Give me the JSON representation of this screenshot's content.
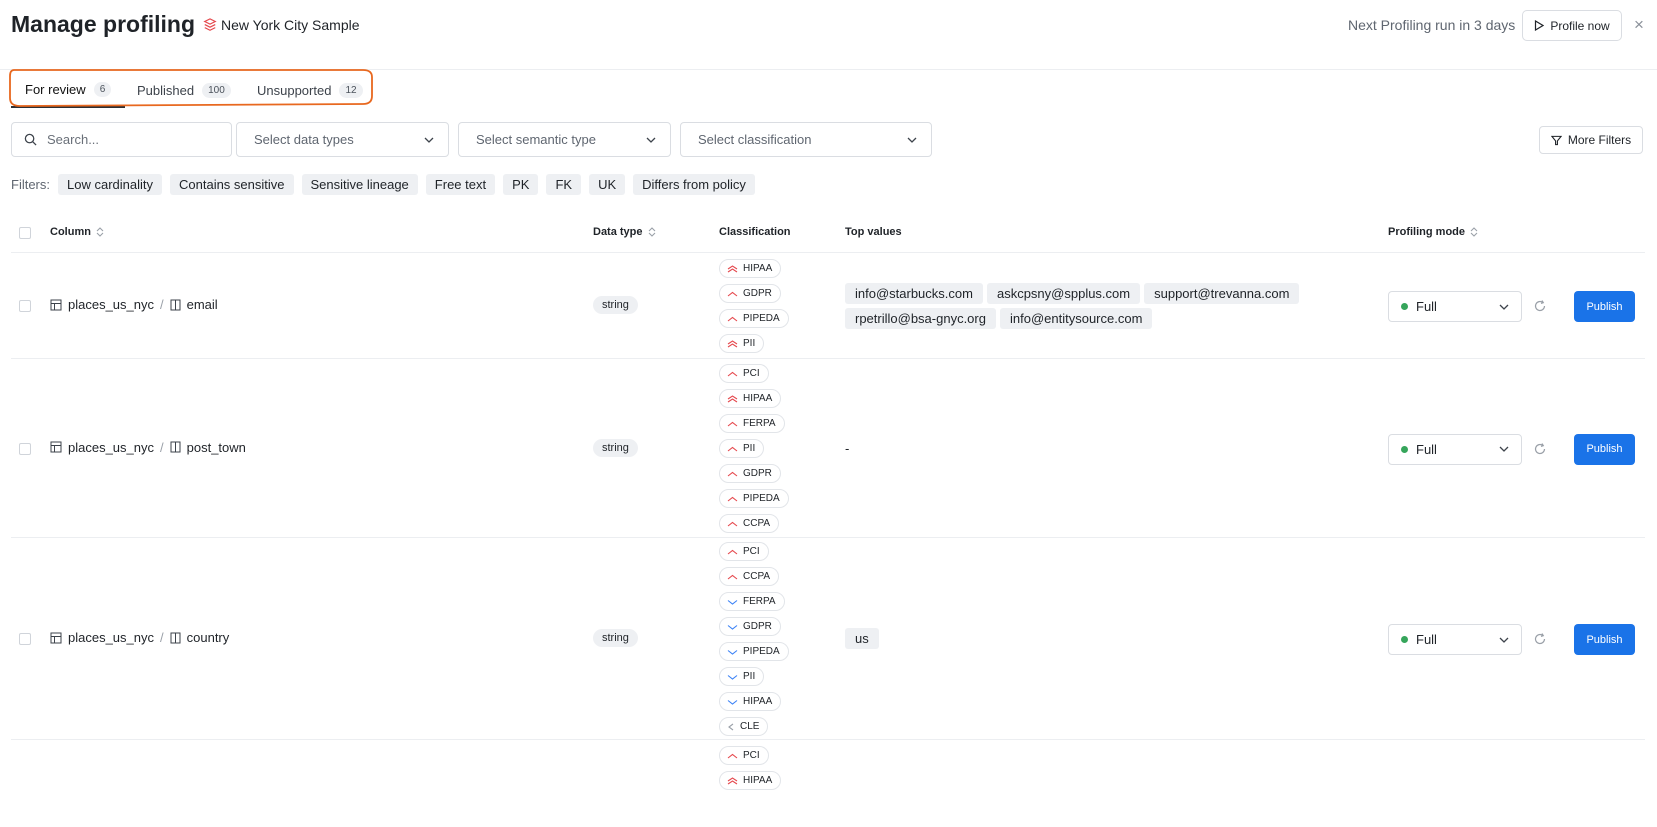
{
  "header": {
    "title": "Manage profiling",
    "dataset": "New York City Sample",
    "next_run": "Next Profiling run in 3 days",
    "profile_now": "Profile now",
    "close": "×"
  },
  "tabs": [
    {
      "label": "For review",
      "count": "6"
    },
    {
      "label": "Published",
      "count": "100"
    },
    {
      "label": "Unsupported",
      "count": "12"
    }
  ],
  "toolbar": {
    "search_placeholder": "Search...",
    "select_data_types": "Select data types",
    "select_semantic_type": "Select semantic type",
    "select_classification": "Select classification",
    "more_filters": "More Filters"
  },
  "filters": {
    "label": "Filters:",
    "chips": [
      "Low cardinality",
      "Contains sensitive",
      "Sensitive lineage",
      "Free text",
      "PK",
      "FK",
      "UK",
      "Differs from policy"
    ]
  },
  "table": {
    "headers": {
      "column": "Column",
      "data_type": "Data type",
      "classification": "Classification",
      "top_values": "Top values",
      "profiling_mode": "Profiling mode"
    },
    "rows": [
      {
        "table": "places_us_nyc",
        "column": "email",
        "data_type": "string",
        "classifications": [
          {
            "label": "HIPAA",
            "level": "high"
          },
          {
            "label": "GDPR",
            "level": "medium"
          },
          {
            "label": "PIPEDA",
            "level": "medium"
          },
          {
            "label": "PII",
            "level": "high"
          }
        ],
        "top_values": [
          "info@starbucks.com",
          "askcpsny@spplus.com",
          "support@trevanna.com",
          "rpetrillo@bsa-gnyc.org",
          "info@entitysource.com"
        ],
        "mode": "Full",
        "publish": "Publish"
      },
      {
        "table": "places_us_nyc",
        "column": "post_town",
        "data_type": "string",
        "classifications": [
          {
            "label": "PCI",
            "level": "medium"
          },
          {
            "label": "HIPAA",
            "level": "high"
          },
          {
            "label": "FERPA",
            "level": "medium"
          },
          {
            "label": "PII",
            "level": "medium"
          },
          {
            "label": "GDPR",
            "level": "medium"
          },
          {
            "label": "PIPEDA",
            "level": "medium"
          },
          {
            "label": "CCPA",
            "level": "medium"
          }
        ],
        "top_values": [],
        "empty_value": "-",
        "mode": "Full",
        "publish": "Publish"
      },
      {
        "table": "places_us_nyc",
        "column": "country",
        "data_type": "string",
        "classifications": [
          {
            "label": "PCI",
            "level": "medium"
          },
          {
            "label": "CCPA",
            "level": "medium"
          },
          {
            "label": "FERPA",
            "level": "low"
          },
          {
            "label": "GDPR",
            "level": "low"
          },
          {
            "label": "PIPEDA",
            "level": "low"
          },
          {
            "label": "PII",
            "level": "low"
          },
          {
            "label": "HIPAA",
            "level": "low"
          },
          {
            "label": "CLE",
            "level": "none"
          }
        ],
        "top_values": [
          "us"
        ],
        "mode": "Full",
        "publish": "Publish"
      },
      {
        "table": "",
        "column": "",
        "data_type": "",
        "classifications": [
          {
            "label": "PCI",
            "level": "medium"
          },
          {
            "label": "HIPAA",
            "level": "high"
          }
        ],
        "top_values": [],
        "mode": "",
        "publish": ""
      }
    ]
  },
  "colors": {
    "accent": "#1a73e8",
    "high": "#e5484d",
    "medium": "#e5484d",
    "low": "#3b82f6",
    "none": "#9aa0a8",
    "mode_dot": "#36a55b",
    "annotation": "#e8681f"
  }
}
